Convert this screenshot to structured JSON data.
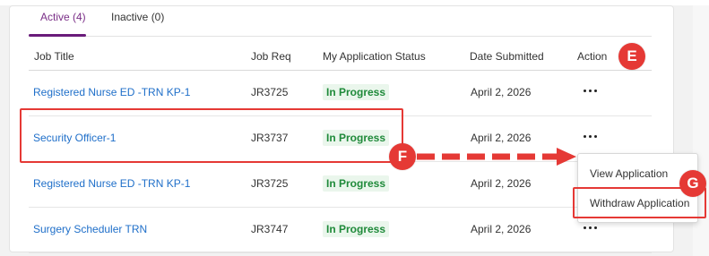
{
  "tabs": [
    {
      "label": "Active (4)",
      "active": true
    },
    {
      "label": "Inactive (0)",
      "active": false
    }
  ],
  "table": {
    "headers": [
      "Job Title",
      "Job Req",
      "My Application Status",
      "Date Submitted",
      "Action"
    ],
    "rows": [
      {
        "job_title": "Registered Nurse ED -TRN KP-1",
        "job_req": "JR3725",
        "status": "In Progress",
        "date": "April 2, 2026"
      },
      {
        "job_title": "Security Officer-1",
        "job_req": "JR3737",
        "status": "In Progress",
        "date": "April 2, 2026"
      },
      {
        "job_title": "Registered Nurse ED -TRN KP-1",
        "job_req": "JR3725",
        "status": "In Progress",
        "date": "April 2, 2026"
      },
      {
        "job_title": "Surgery Scheduler TRN",
        "job_req": "JR3747",
        "status": "In Progress",
        "date": "April 2, 2026"
      }
    ]
  },
  "action_menu": {
    "items": [
      "View Application",
      "Withdraw Application"
    ]
  },
  "annotations": {
    "badge_e": "E",
    "badge_f": "F",
    "badge_g": "G"
  },
  "colors": {
    "accent_purple": "#6a1b7a",
    "link_blue": "#1f6fc9",
    "status_green": "#1f8a3a",
    "annotation_red": "#e53935"
  },
  "icons": {
    "action": "more-horizontal-icon"
  }
}
